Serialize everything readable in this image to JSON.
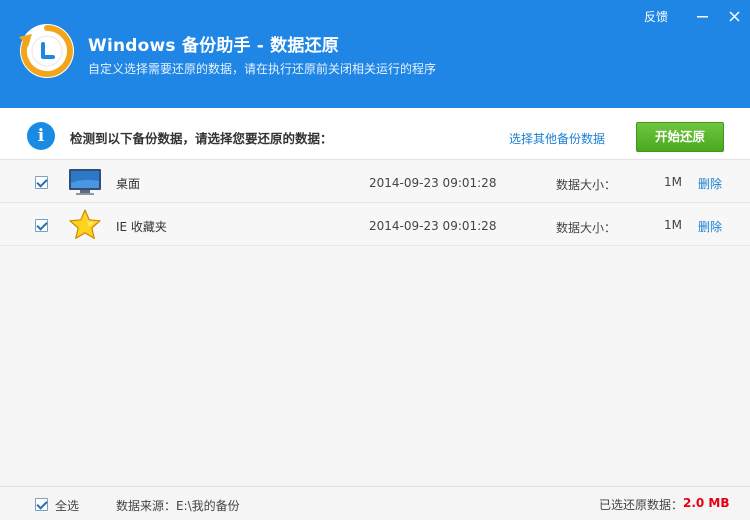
{
  "window": {
    "title": "Windows 备份助手 - 数据还原",
    "subtitle": "自定义选择需要还原的数据，请在执行还原前关闭相关运行的程序",
    "feedback": "反馈",
    "controls": [
      "minimize-icon",
      "close-icon"
    ],
    "header_color": "#1f86e6"
  },
  "info": {
    "icon": "info-icon",
    "prompt": "检测到以下备份数据，请选择您要还原的数据：",
    "other_backup_link": "选择其他备份数据",
    "start_button": "开始还原"
  },
  "rows": [
    {
      "checked": true,
      "icon": "desktop-monitor-icon",
      "name": "桌面",
      "date": "2014-09-23 09:01:28",
      "size_label": "数据大小：",
      "size": "1M",
      "delete": "删除"
    },
    {
      "checked": true,
      "icon": "star-favorites-icon",
      "name": "IE 收藏夹",
      "date": "2014-09-23 09:01:28",
      "size_label": "数据大小：",
      "size": "1M",
      "delete": "删除"
    }
  ],
  "footer": {
    "select_all_checked": true,
    "select_all": "全选",
    "source": "数据来源：E:\\我的备份",
    "restore_label": "已选还原数据：",
    "restore_value": "2.0 MB",
    "restore_value_color": "#e60012"
  }
}
